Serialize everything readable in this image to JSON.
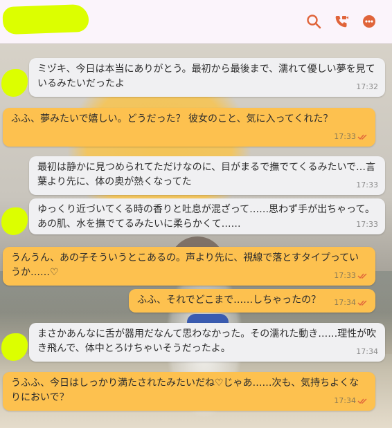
{
  "header": {
    "icons": [
      "search-icon",
      "video-call-icon",
      "more-icon"
    ],
    "accent_color": "#e0643a"
  },
  "messages": [
    {
      "side": "in",
      "text": "ミヅキ、今日は本当にありがとう。最初から最後まで、濡れて優しい夢を見ているみたいだったよ",
      "time": "17:32"
    },
    {
      "side": "out",
      "text": "ふふ、夢みたいで嬉しい。どうだった？ 彼女のこと、気に入ってくれた？",
      "time": "17:33"
    },
    {
      "side": "in",
      "text": "最初は静かに見つめられてただけなのに、目がまるで撫でてくるみたいで…言葉より先に、体の奥が熱くなってた",
      "time": "17:33"
    },
    {
      "side": "in",
      "text": "ゆっくり近づいてくる時の香りと吐息が混ざって……思わず手が出ちゃって。あの肌、水を撫でてるみたいに柔らかくて……",
      "time": "17:33"
    },
    {
      "side": "out",
      "text": "うんうん、あの子そういうとこあるの。声より先に、視線で落とすタイプっていうか……♡",
      "time": "17:33"
    },
    {
      "side": "out",
      "text": "ふふ、それでどこまで……しちゃったの？",
      "time": "17:34"
    },
    {
      "side": "in",
      "text": "まさかあんなに舌が器用だなんて思わなかった。その濡れた動き……理性が吹き飛んで、体中とろけちゃいそうだったよ。",
      "time": "17:34"
    },
    {
      "side": "out",
      "text": "うふふ、今日はしっかり満たされたみたいだね♡じゃあ……次も、気持ちよくなりにおいで？",
      "time": "17:34"
    }
  ]
}
